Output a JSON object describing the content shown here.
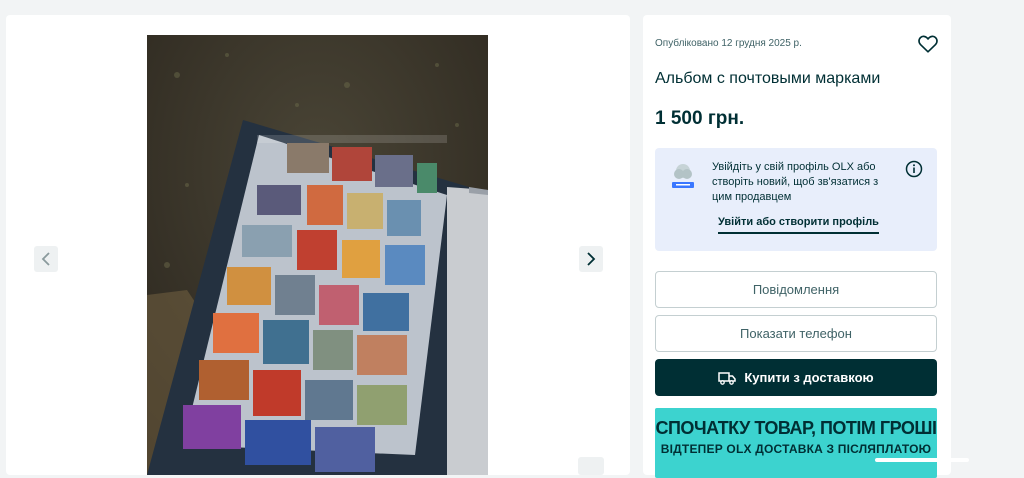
{
  "listing": {
    "published": "Опубліковано 12 грудня 2025 р.",
    "title": "Альбом с почтовыми марками",
    "price": "1 500 грн."
  },
  "login_prompt": {
    "text": "Увійдіть у свій профіль OLX або створіть новий, щоб зв'язатися з цим продавцем",
    "link": "Увійти або створити профіль"
  },
  "actions": {
    "message": "Повідомлення",
    "phone": "Показати телефон",
    "buy": "Купити з доставкою"
  },
  "promo": {
    "line1": "СПОЧАТКУ ТОВАР, ПОТІМ ГРОШІ",
    "line2": "ВІДТЕПЕР OLX ДОСТАВКА З ПІСЛЯПЛАТОЮ"
  },
  "icons": {
    "favorite": "heart-icon",
    "info": "info-icon",
    "prev": "chevron-left-icon",
    "next": "chevron-right-icon",
    "delivery": "truck-icon"
  },
  "colors": {
    "primary": "#002f34",
    "login_bg": "#e8eefb",
    "promo_bg": "#3cd3cf"
  }
}
